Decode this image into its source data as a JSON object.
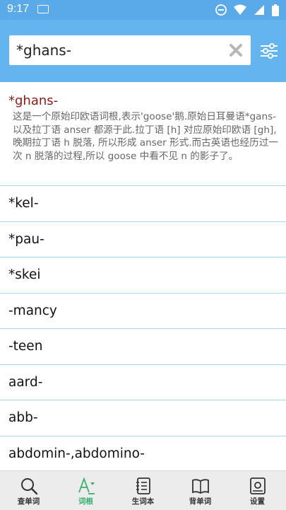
{
  "status": {
    "time": "9:17"
  },
  "search": {
    "value": "*ghans-"
  },
  "detail": {
    "word": "*ghans-",
    "text": "这是一个原始印欧语词根,表示'goose'鹅.原始日耳曼语*gans- 以及拉丁语 anser 都源于此.拉丁语 [h] 对应原始印欧语 [gh], 晚期拉丁语 h 脱落, 所以形成 anser 形式.而古英语也经历过一次 n 脱落的过程,所以 goose 中看不见 n 的影子了。"
  },
  "list": [
    {
      "label": "*kel-"
    },
    {
      "label": "*pau-"
    },
    {
      "label": "*skei"
    },
    {
      "label": "-mancy"
    },
    {
      "label": "-teen"
    },
    {
      "label": "aard-"
    },
    {
      "label": "abb-"
    },
    {
      "label": "abdomin-,abdomino-"
    }
  ],
  "nav": [
    {
      "label": "查单词",
      "icon": "magnifier-icon"
    },
    {
      "label": "词根",
      "icon": "root-icon",
      "active": true
    },
    {
      "label": "生词本",
      "icon": "notebook-icon"
    },
    {
      "label": "背单词",
      "icon": "book-icon"
    },
    {
      "label": "设置",
      "icon": "settings-icon"
    }
  ],
  "colors": {
    "header": "#64b4f0",
    "statusbar": "#5aa9e8",
    "accent": "#38b06a",
    "word": "#8b1a1a",
    "divider": "#a9d4f2"
  }
}
